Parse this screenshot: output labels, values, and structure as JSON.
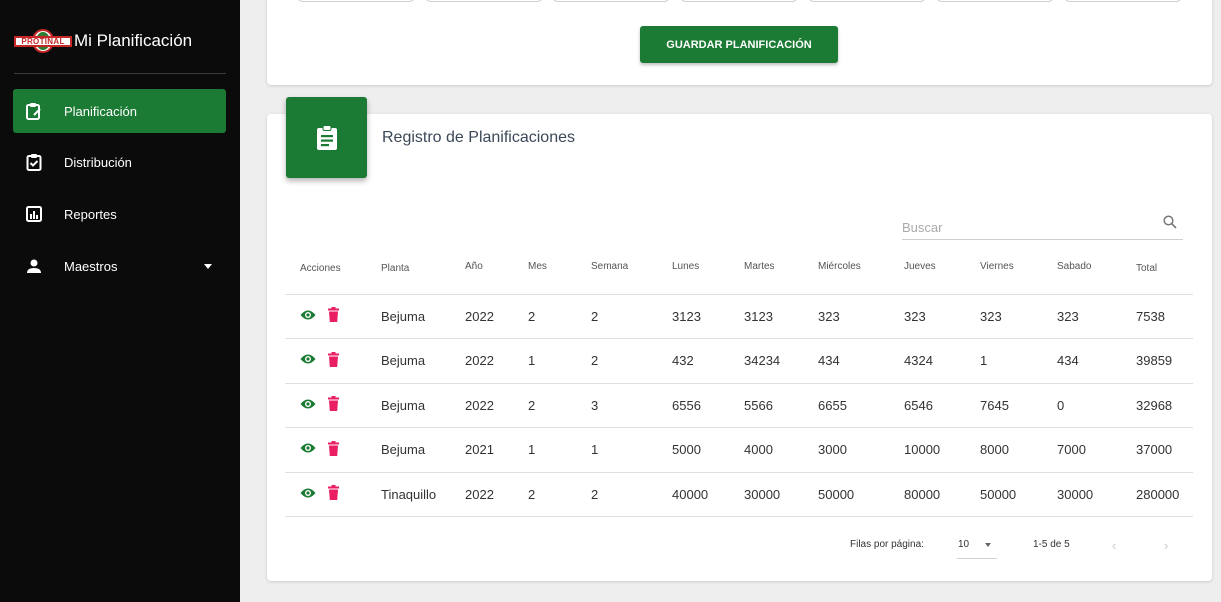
{
  "brand": {
    "logo_text": "PROTINAL",
    "title": "Mi Planificación"
  },
  "sidebar": {
    "items": [
      {
        "label": "Planificación",
        "icon": "clipboard-edit-icon",
        "active": true
      },
      {
        "label": "Distribución",
        "icon": "clipboard-check-icon",
        "active": false
      },
      {
        "label": "Reportes",
        "icon": "bar-chart-icon",
        "active": false
      },
      {
        "label": "Maestros",
        "icon": "person-icon",
        "active": false
      }
    ]
  },
  "top": {
    "save_label": "GUARDAR PLANIFICACIÓN"
  },
  "card": {
    "title": "Registro de Planificaciones",
    "icon": "clipboard-list-icon",
    "search_placeholder": "Buscar"
  },
  "table": {
    "headers": [
      "Acciones",
      "Planta",
      "Año",
      "Mes",
      "Semana",
      "Lunes",
      "Martes",
      "Miércoles",
      "Jueves",
      "Viernes",
      "Sabado",
      "Total"
    ],
    "rows": [
      [
        "Bejuma",
        "2022",
        "2",
        "2",
        "3123",
        "3123",
        "323",
        "323",
        "323",
        "323",
        "7538"
      ],
      [
        "Bejuma",
        "2022",
        "1",
        "2",
        "432",
        "34234",
        "434",
        "4324",
        "1",
        "434",
        "39859"
      ],
      [
        "Bejuma",
        "2022",
        "2",
        "3",
        "6556",
        "5566",
        "6655",
        "6546",
        "7645",
        "0",
        "32968"
      ],
      [
        "Bejuma",
        "2021",
        "1",
        "1",
        "5000",
        "4000",
        "3000",
        "10000",
        "8000",
        "7000",
        "37000"
      ],
      [
        "Tinaquillo",
        "2022",
        "2",
        "2",
        "40000",
        "30000",
        "50000",
        "80000",
        "50000",
        "30000",
        "280000"
      ]
    ]
  },
  "pagination": {
    "rows_per_page_label": "Filas por página:",
    "rows_per_page": "10",
    "range": "1-5 de 5"
  },
  "colors": {
    "primary": "#1b7a33",
    "delete": "#e91e63",
    "sidebar_bg": "#0b0b0b"
  }
}
